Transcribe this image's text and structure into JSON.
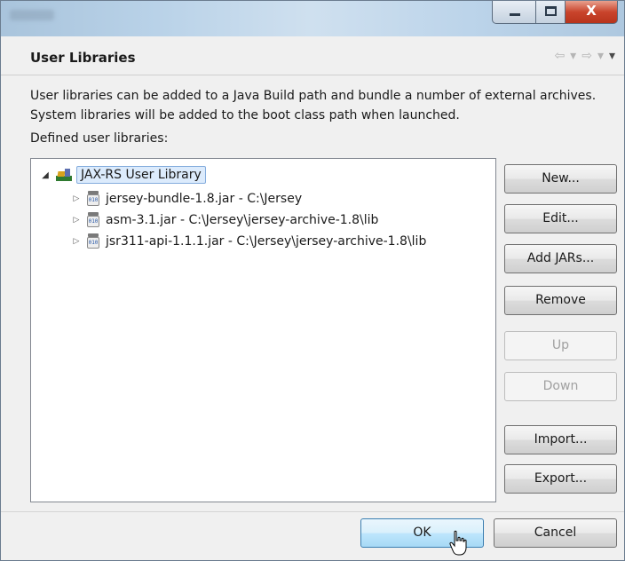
{
  "window": {
    "close_glyph": "X"
  },
  "header": {
    "title": "User Libraries",
    "nav": [
      "⇦",
      "▾",
      "⇨",
      "▾",
      "▾"
    ]
  },
  "description": "User libraries can be added to a Java Build path and bundle a number of external archives. System libraries will be added to the boot class path when launched.",
  "defined_label": "Defined user libraries:",
  "tree": {
    "root": {
      "label": "JAX-RS User Library",
      "expanded": true
    },
    "children": [
      {
        "label": "jersey-bundle-1.8.jar - C:\\Jersey"
      },
      {
        "label": "asm-3.1.jar - C:\\Jersey\\jersey-archive-1.8\\lib"
      },
      {
        "label": "jsr311-api-1.1.1.jar - C:\\Jersey\\jersey-archive-1.8\\lib"
      }
    ],
    "jar_icon_text": "010"
  },
  "buttons": {
    "new": "New...",
    "edit": "Edit...",
    "add_jars": "Add JARs...",
    "remove": "Remove",
    "up": "Up",
    "down": "Down",
    "import": "Import...",
    "export": "Export..."
  },
  "footer": {
    "ok": "OK",
    "cancel": "Cancel"
  }
}
